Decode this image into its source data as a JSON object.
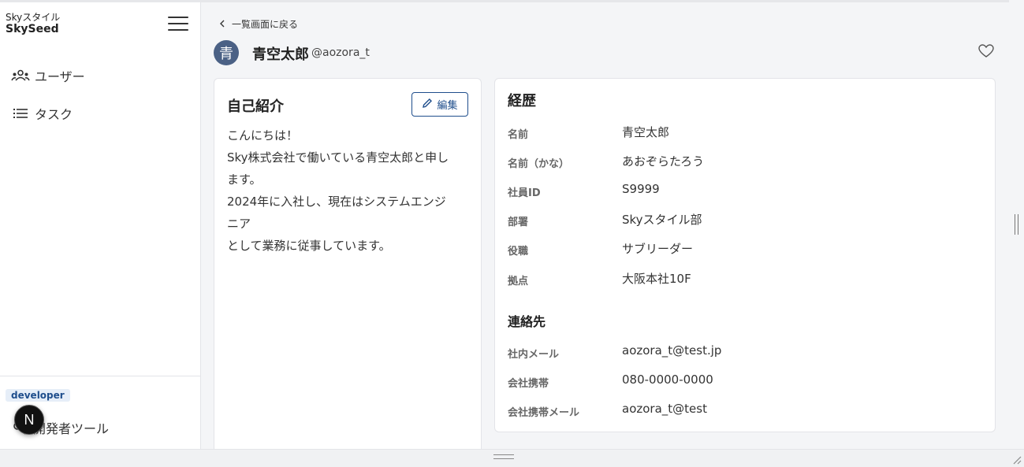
{
  "sidebar": {
    "brand_sub": "Skyスタイル",
    "brand_main": "SkySeed",
    "menu_icon": "hamburger-menu-icon",
    "items": [
      {
        "label": "ユーザー",
        "icon": "users-icon"
      },
      {
        "label": "タスク",
        "icon": "list-icon"
      }
    ],
    "badge": "developer",
    "dev_tools_label": "開発者ツール",
    "next_badge": "N"
  },
  "header": {
    "back_label": "一覧画面に戻る",
    "avatar_initial": "青",
    "name": "青空太郎",
    "handle": "@aozora_t"
  },
  "intro": {
    "title": "自己紹介",
    "edit_label": "編集",
    "lines": [
      "こんにちは！",
      "Sky株式会社で働いている青空太郎と申し",
      "ます。",
      "2024年に入社し、現在はシステムエンジ",
      "ニア",
      "として業務に従事しています。"
    ]
  },
  "history": {
    "title": "経歴",
    "rows": [
      {
        "label": "名前",
        "value": "青空太郎"
      },
      {
        "label": "名前（かな）",
        "value": "あおぞらたろう"
      },
      {
        "label": "社員ID",
        "value": "S9999"
      },
      {
        "label": "部署",
        "value": "Skyスタイル部"
      },
      {
        "label": "役職",
        "value": "サブリーダー"
      },
      {
        "label": "拠点",
        "value": "大阪本社10F"
      }
    ],
    "contact_title": "連絡先",
    "contact_rows": [
      {
        "label": "社内メール",
        "value": "aozora_t@test.jp"
      },
      {
        "label": "会社携帯",
        "value": "080-0000-0000"
      },
      {
        "label": "会社携帯メール",
        "value": "aozora_t@test"
      }
    ]
  },
  "colors": {
    "accent": "#1f4e8c",
    "avatar_bg": "#4b6185",
    "badge_bg": "#e6eef8"
  }
}
